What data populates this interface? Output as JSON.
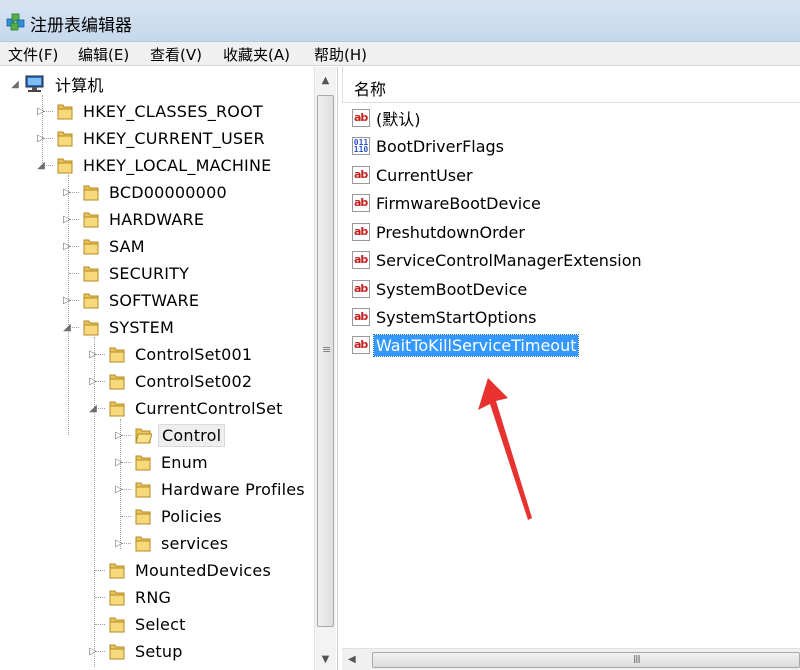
{
  "window": {
    "title": "注册表编辑器",
    "icon": "regedit-icon"
  },
  "menu": [
    "文件(F)",
    "编辑(E)",
    "查看(V)",
    "收藏夹(A)",
    "帮助(H)"
  ],
  "tree": {
    "root": "计算机",
    "hkcr": "HKEY_CLASSES_ROOT",
    "hkcu": "HKEY_CURRENT_USER",
    "hklm": "HKEY_LOCAL_MACHINE",
    "bcd": "BCD00000000",
    "hardware": "HARDWARE",
    "sam": "SAM",
    "security": "SECURITY",
    "software": "SOFTWARE",
    "system": "SYSTEM",
    "cs001": "ControlSet001",
    "cs002": "ControlSet002",
    "ccs": "CurrentControlSet",
    "control": "Control",
    "enum": "Enum",
    "hwprofiles": "Hardware Profiles",
    "policies": "Policies",
    "services": "services",
    "mounted": "MountedDevices",
    "rng": "RNG",
    "select": "Select",
    "setup": "Setup"
  },
  "list": {
    "column_header": "名称",
    "values": [
      {
        "name": "(默认)",
        "type": "string"
      },
      {
        "name": "BootDriverFlags",
        "type": "binary"
      },
      {
        "name": "CurrentUser",
        "type": "string"
      },
      {
        "name": "FirmwareBootDevice",
        "type": "string"
      },
      {
        "name": "PreshutdownOrder",
        "type": "string"
      },
      {
        "name": "ServiceControlManagerExtension",
        "type": "string"
      },
      {
        "name": "SystemBootDevice",
        "type": "string"
      },
      {
        "name": "SystemStartOptions",
        "type": "string"
      },
      {
        "name": "WaitToKillServiceTimeout",
        "type": "string"
      }
    ],
    "selected_value": "WaitToKillServiceTimeout"
  },
  "icons": {
    "string_icon_text": "ab",
    "binary_icon_text": "011 110",
    "arrow_color": "#e8322f",
    "selection_color": "#3399ff"
  },
  "scroll": {
    "grip_vertical": "≡",
    "grip_horizontal": "III"
  }
}
